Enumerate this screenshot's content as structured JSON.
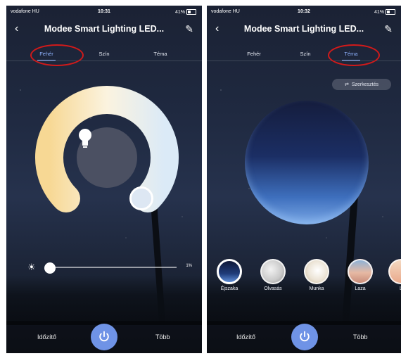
{
  "status_left": {
    "carrier": "vodafone HU",
    "time": "10:31",
    "battery": "41%"
  },
  "status_right": {
    "carrier": "vodafone HU",
    "time": "10:32",
    "battery": "41%"
  },
  "header": {
    "title": "Modee Smart Lighting LED...",
    "back_icon": "chevron-left-icon",
    "edit_icon": "pencil-icon"
  },
  "tabs": [
    {
      "label": "Fehér"
    },
    {
      "label": "Szín"
    },
    {
      "label": "Téma"
    }
  ],
  "left_panel": {
    "active_tab": "Fehér",
    "brightness_label": "1%",
    "brightness_value": 1,
    "center_icon": "bulb-icon",
    "ring_colors": [
      "#f7d894",
      "#fbf3df",
      "#dbeaf7"
    ]
  },
  "right_panel": {
    "active_tab": "Téma",
    "edit_chip": "Szerkesztés",
    "scenes": [
      {
        "label": "Éjszaka",
        "active": true
      },
      {
        "label": "Olvasás",
        "active": false
      },
      {
        "label": "Munka",
        "active": false
      },
      {
        "label": "Laza",
        "active": false
      },
      {
        "label": "L",
        "active": false
      }
    ]
  },
  "bottom_bar": {
    "timer_label": "Időzítő",
    "more_label": "Több",
    "power_icon": "power-icon"
  },
  "colors": {
    "accent": "#8fb3ff",
    "power_button": "#6f93e6",
    "highlight_circle": "#d11a1a"
  }
}
